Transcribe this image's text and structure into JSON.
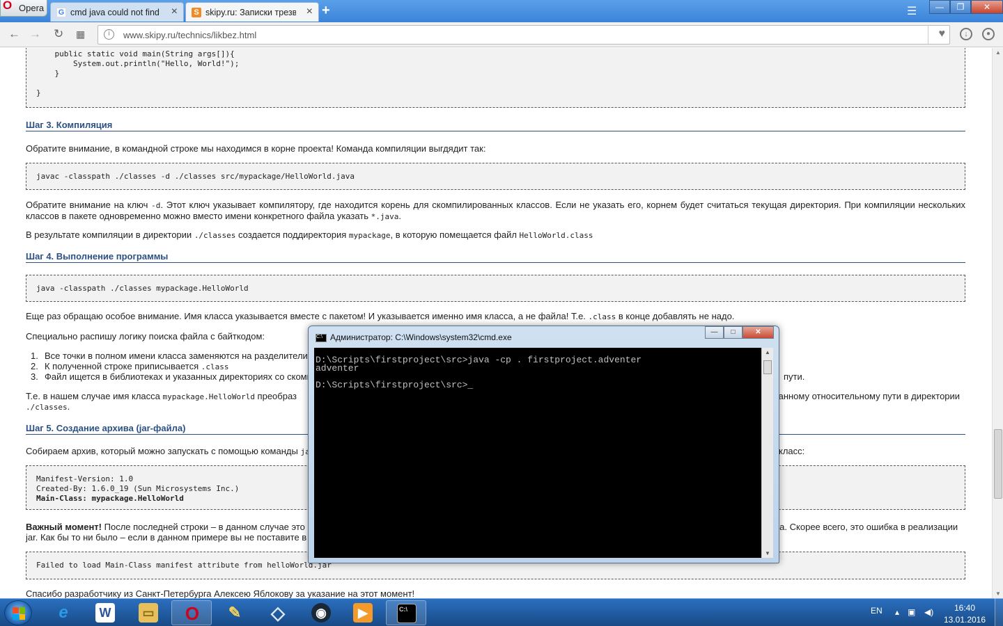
{
  "browser": {
    "menu_label": "Opera",
    "tabs": [
      {
        "title": "cmd java could not find m",
        "favicon": "google-icon",
        "active": false
      },
      {
        "title": "skipy.ru: Записки трезвог",
        "favicon": "skipy-icon",
        "active": true
      }
    ],
    "new_tab": "+",
    "url": "www.skipy.ru/technics/likbez.html"
  },
  "article": {
    "code_main": "    public static void main(String args[]){\n        System.out.println(\"Hello, World!\");\n    }\n\n}",
    "h_step3": "Шаг 3. Компиляция",
    "p_step3_intro": "Обратите внимание, в командной строке мы находимся в корне проекта! Команда компиляции выгдядит так:",
    "code_compile": "javac -classpath ./classes -d ./classes src/mypackage/HelloWorld.java",
    "p_d_a": "Обратите внимание на ключ ",
    "p_d_flag": "-d",
    "p_d_b": ". Этот ключ указывает компилятору, где находится корень для скомпилированных классов. Если не указать его, корнем будет считаться текущая директория. При компиляции нескольких классов в пакете одновременно можно вместо имени конкретного файла указать ",
    "p_d_glob": "*.java",
    "p_d_c": ".",
    "p_result_a": "В результате компиляции в директории ",
    "p_result_dir": "./classes",
    "p_result_b": " создается поддиректория ",
    "p_result_pkg": "mypackage",
    "p_result_c": ", в которую помещается файл ",
    "p_result_file": "HelloWorld.class",
    "h_step4": "Шаг 4. Выполнение программы",
    "code_run": "java -classpath ./classes mypackage.HelloWorld",
    "p_note_a": "Еще раз обращаю особое внимание. Имя класса указывается вместе с пакетом! И указывается именно имя класса, а не файла! Т.е. ",
    "p_note_ext": ".class",
    "p_note_b": " в конце добавлять не надо.",
    "p_logic": "Специально распишу логику поиска файла с байткодом:",
    "list": [
      {
        "num": "1.",
        "text": "Все точки в полном имени класса заменяются на разделители",
        "code": ""
      },
      {
        "num": "2.",
        "text": "К полученной строке приписывается ",
        "code": ".class"
      },
      {
        "num": "3.",
        "text": "Файл ищется в библиотеках и указанных директориях со скомп",
        "code": ""
      }
    ],
    "list3_tail": "пути.",
    "p_ie_a": "Т.е. в нашем случае имя класса ",
    "p_ie_code": "mypackage.HelloWorld",
    "p_ie_b": " преобраз",
    "p_ie_tail": "данному относительному пути в директории",
    "p_ie_dir": "./classes",
    "p_ie_end": ".",
    "h_step5": "Шаг 5. Создание архива (jar-файла)",
    "p_archive_a": "Собираем архив, который можно запускать с помощью команды ",
    "p_archive_code": "ja",
    "p_archive_tail": "класс:",
    "manifest": [
      {
        "text": "Manifest-Version: 1.0",
        "bold": false
      },
      {
        "text": "Created-By: 1.6.0_19 (Sun Microsystems Inc.)",
        "bold": false
      },
      {
        "text": "Main-Class: mypackage.HelloWorld",
        "bold": true
      }
    ],
    "p_important_bold": "Важный момент!",
    "p_important_a": " После последней строки – в данном случае это ",
    "p_important_tail": "на. Скорее всего, это ошибка в реализации",
    "p_important_b": "jar. Как бы то ни было – если в данном примере вы не поставите в",
    "code_error": "Failed to load Main-Class manifest attribute from helloWorld.jar",
    "p_thanks": "Спасибо разработчику из Санкт-Петербурга Алексею Яблокову за указание на этот момент!"
  },
  "cmd": {
    "title": "Администратор: C:\\Windows\\system32\\cmd.exe",
    "icon_label": "C:\\",
    "console": "D:\\Scripts\\firstproject\\src>java -cp . firstproject.adventer\nadventer\n\nD:\\Scripts\\firstproject\\src>_"
  },
  "taskbar": {
    "apps": [
      {
        "name": "internet-explorer",
        "label": "e",
        "color": "#2a9be8",
        "open": false
      },
      {
        "name": "word",
        "label": "W",
        "color": "#2a5699",
        "open": false
      },
      {
        "name": "explorer",
        "label": "▭",
        "color": "#e8c05a",
        "open": false
      },
      {
        "name": "opera",
        "label": "O",
        "color": "#d0021b",
        "open": true
      },
      {
        "name": "paint",
        "label": "✎",
        "color": "#8bbce8",
        "open": false
      },
      {
        "name": "virtualbox",
        "label": "◇",
        "color": "#c9d9ef",
        "open": false
      },
      {
        "name": "steam",
        "label": "◉",
        "color": "#1b2838",
        "open": false
      },
      {
        "name": "media-player",
        "label": "▶",
        "color": "#f39a2a",
        "open": false
      },
      {
        "name": "cmd",
        "label": "C:\\",
        "color": "#000000",
        "open": true
      }
    ],
    "lang": "EN",
    "time": "16:40",
    "date": "13.01.2016"
  }
}
